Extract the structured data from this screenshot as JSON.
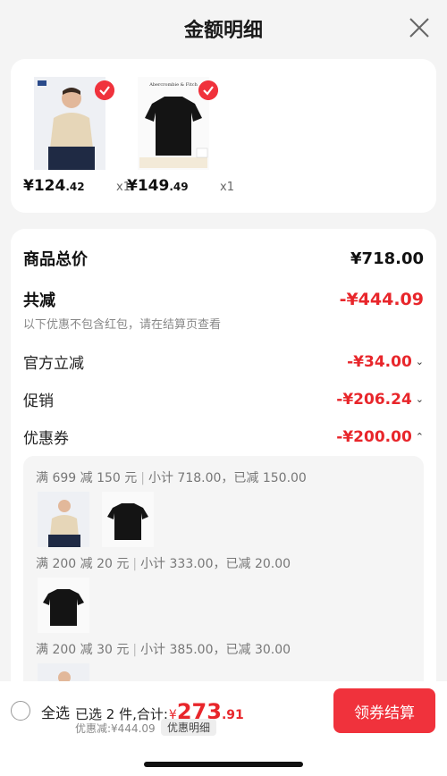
{
  "header": {
    "title": "金额明细"
  },
  "products": [
    {
      "brand": "navigare",
      "price_main": "¥124",
      "price_dec": ".42",
      "qty": "x1",
      "icon": "polo-shirt-model"
    },
    {
      "brand": "Abercrombie & Fitch",
      "price_main": "¥149",
      "price_dec": ".49",
      "qty": "x1",
      "icon": "black-tshirt"
    }
  ],
  "summary": {
    "total_label": "商品总价",
    "total_value": "¥718.00",
    "reduce_label": "共减",
    "reduce_value": "-¥444.09",
    "note": "以下优惠不包含红包，请在结算页查看",
    "official_label": "官方立减",
    "official_value": "-¥34.00",
    "promo_label": "促销",
    "promo_value": "-¥206.24",
    "coupon_label": "优惠券",
    "coupon_value": "-¥200.00"
  },
  "coupons": [
    {
      "rule": "满 699 减 150 元",
      "detail": "小计 718.00，已减 150.00"
    },
    {
      "rule": "满 200 减 20 元",
      "detail": "小计 333.00，已减 20.00"
    },
    {
      "rule": "满 200 减 30 元",
      "detail": "小计 385.00，已减 30.00"
    }
  ],
  "bottom": {
    "select_all": "全选",
    "selected_text": "已选 2 件,合计:",
    "currency": "¥",
    "total_int": "273",
    "total_dec": ".91",
    "discount": "优惠减:¥444.09",
    "detail_button": "优惠明细",
    "pay_button": "领券结算"
  },
  "colors": {
    "accent": "#f0323c",
    "price_red": "#e8262b"
  }
}
